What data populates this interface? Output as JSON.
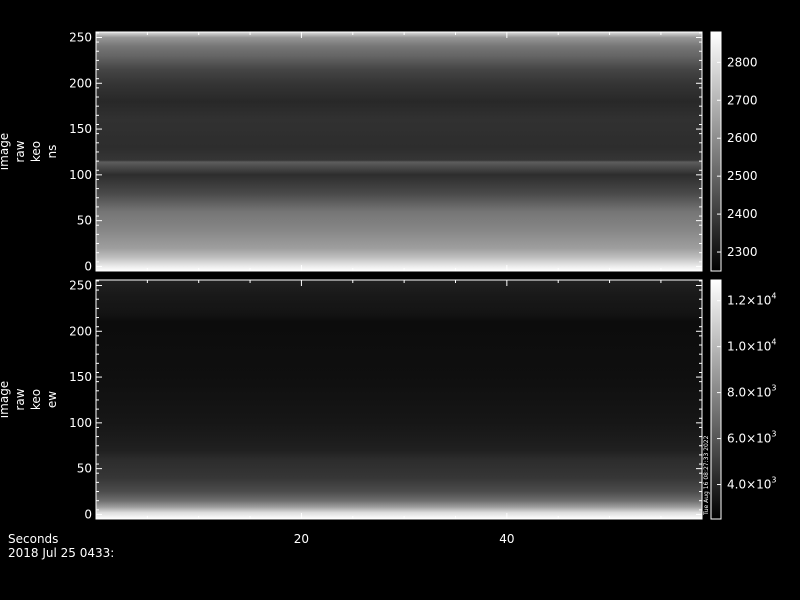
{
  "footer": {
    "axis_label": "Seconds",
    "date_label": "2018 Jul 25 0433:"
  },
  "chart_data": [
    {
      "type": "heatmap",
      "ylabel_lines": [
        "image",
        "raw",
        "keo",
        "ns"
      ],
      "xlim": [
        0,
        59
      ],
      "ylim": [
        -5,
        256
      ],
      "yticks": [
        0,
        50,
        100,
        150,
        200,
        250
      ],
      "xticks": [
        20,
        40
      ],
      "colorbar": {
        "range": [
          2250,
          2880
        ],
        "ticks": [
          {
            "value": 2300,
            "label": "2300"
          },
          {
            "value": 2400,
            "label": "2400"
          },
          {
            "value": 2500,
            "label": "2500"
          },
          {
            "value": 2600,
            "label": "2600"
          },
          {
            "value": 2700,
            "label": "2700"
          },
          {
            "value": 2800,
            "label": "2800"
          }
        ],
        "scale": "grayscale"
      },
      "row_profile": [
        {
          "y": -5,
          "value": 2880
        },
        {
          "y": 0,
          "value": 2830
        },
        {
          "y": 10,
          "value": 2720
        },
        {
          "y": 20,
          "value": 2640
        },
        {
          "y": 40,
          "value": 2580
        },
        {
          "y": 60,
          "value": 2540
        },
        {
          "y": 80,
          "value": 2430
        },
        {
          "y": 100,
          "value": 2360
        },
        {
          "y": 114,
          "value": 2480
        },
        {
          "y": 116,
          "value": 2380
        },
        {
          "y": 130,
          "value": 2360
        },
        {
          "y": 160,
          "value": 2370
        },
        {
          "y": 180,
          "value": 2350
        },
        {
          "y": 200,
          "value": 2380
        },
        {
          "y": 215,
          "value": 2420
        },
        {
          "y": 230,
          "value": 2500
        },
        {
          "y": 240,
          "value": 2540
        },
        {
          "y": 250,
          "value": 2620
        },
        {
          "y": 256,
          "value": 2800
        }
      ]
    },
    {
      "type": "heatmap",
      "ylabel_lines": [
        "image",
        "raw",
        "keo",
        "ew"
      ],
      "xlim": [
        0,
        59
      ],
      "ylim": [
        -5,
        256
      ],
      "yticks": [
        0,
        50,
        100,
        150,
        200,
        250
      ],
      "xticks": [
        20,
        40
      ],
      "colorbar": {
        "range": [
          2500,
          12900
        ],
        "ticks": [
          {
            "value": 4000,
            "mantissa": "4.0",
            "exponent": "3"
          },
          {
            "value": 6000,
            "mantissa": "6.0",
            "exponent": "3"
          },
          {
            "value": 8000,
            "mantissa": "8.0",
            "exponent": "3"
          },
          {
            "value": 10000,
            "mantissa": "1.0",
            "exponent": "4"
          },
          {
            "value": 12000,
            "mantissa": "1.2",
            "exponent": "4"
          }
        ],
        "scale": "grayscale",
        "side_text": "Tue Aug 16 08:27:33 2022"
      },
      "row_profile": [
        {
          "y": -5,
          "value": 12900
        },
        {
          "y": 2,
          "value": 11500
        },
        {
          "y": 8,
          "value": 9000
        },
        {
          "y": 15,
          "value": 7000
        },
        {
          "y": 25,
          "value": 5600
        },
        {
          "y": 40,
          "value": 4700
        },
        {
          "y": 60,
          "value": 4300
        },
        {
          "y": 70,
          "value": 3800
        },
        {
          "y": 100,
          "value": 3400
        },
        {
          "y": 150,
          "value": 3100
        },
        {
          "y": 210,
          "value": 3000
        },
        {
          "y": 220,
          "value": 3300
        },
        {
          "y": 240,
          "value": 3500
        },
        {
          "y": 256,
          "value": 3900
        }
      ]
    }
  ]
}
